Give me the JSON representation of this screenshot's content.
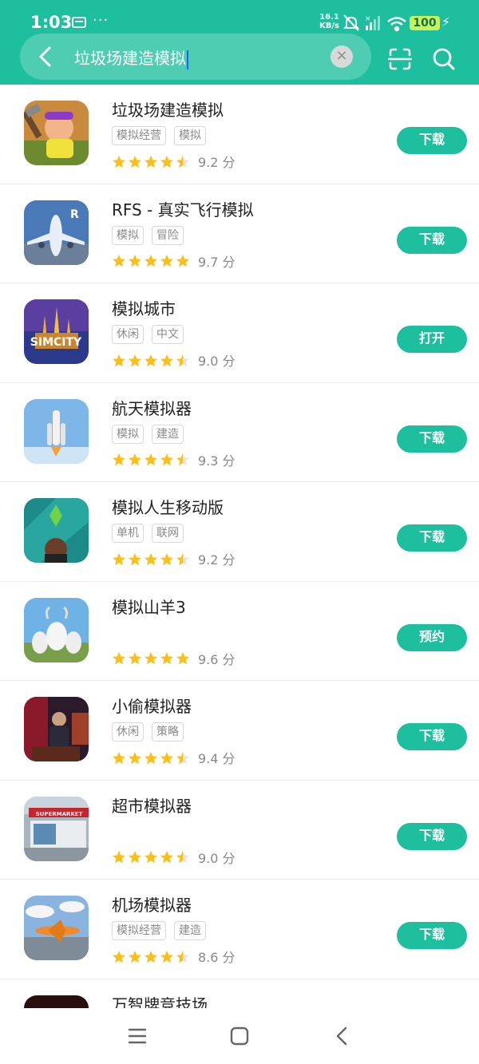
{
  "status": {
    "time": "1:03",
    "dots": "···",
    "speed_value": "16.1",
    "speed_unit": "KB/s",
    "battery": "100"
  },
  "search": {
    "query": "垃圾场建造模拟",
    "clear_symbol": "×"
  },
  "colors": {
    "accent": "#1dbf9e",
    "star": "#fbbf1a",
    "star_empty": "#e3e3e3"
  },
  "apps": [
    {
      "name": "垃圾场建造模拟",
      "tags": [
        "模拟经营",
        "模拟"
      ],
      "stars": 4.5,
      "score": "9.2 分",
      "action": "下载",
      "icon": "junkyard-icon"
    },
    {
      "name": "RFS - 真实飞行模拟",
      "tags": [
        "模拟",
        "冒险"
      ],
      "stars": 5,
      "score": "9.7 分",
      "action": "下载",
      "icon": "airplane-icon"
    },
    {
      "name": "模拟城市",
      "tags": [
        "休闲",
        "中文"
      ],
      "stars": 4.5,
      "score": "9.0 分",
      "action": "打开",
      "icon": "simcity-icon"
    },
    {
      "name": "航天模拟器",
      "tags": [
        "模拟",
        "建造"
      ],
      "stars": 4.5,
      "score": "9.3 分",
      "action": "下载",
      "icon": "rocket-icon"
    },
    {
      "name": "模拟人生移动版",
      "tags": [
        "单机",
        "联网"
      ],
      "stars": 4.5,
      "score": "9.2 分",
      "action": "下载",
      "icon": "sims-icon"
    },
    {
      "name": "模拟山羊3",
      "tags": [],
      "stars": 5,
      "score": "9.6 分",
      "action": "预约",
      "icon": "goat-icon"
    },
    {
      "name": "小偷模拟器",
      "tags": [
        "休闲",
        "策略"
      ],
      "stars": 4.5,
      "score": "9.4 分",
      "action": "下载",
      "icon": "thief-icon"
    },
    {
      "name": "超市模拟器",
      "tags": [],
      "stars": 4.5,
      "score": "9.0 分",
      "action": "下载",
      "icon": "supermarket-icon",
      "icon_text": "SUPERMARKET"
    },
    {
      "name": "机场模拟器",
      "tags": [
        "模拟经营",
        "建造"
      ],
      "stars": 4.5,
      "score": "8.6 分",
      "action": "下载",
      "icon": "airport-icon"
    },
    {
      "name": "万智牌竞技场",
      "tags": [],
      "stars": 0,
      "score": "",
      "action": "",
      "icon": "mtg-icon"
    }
  ]
}
